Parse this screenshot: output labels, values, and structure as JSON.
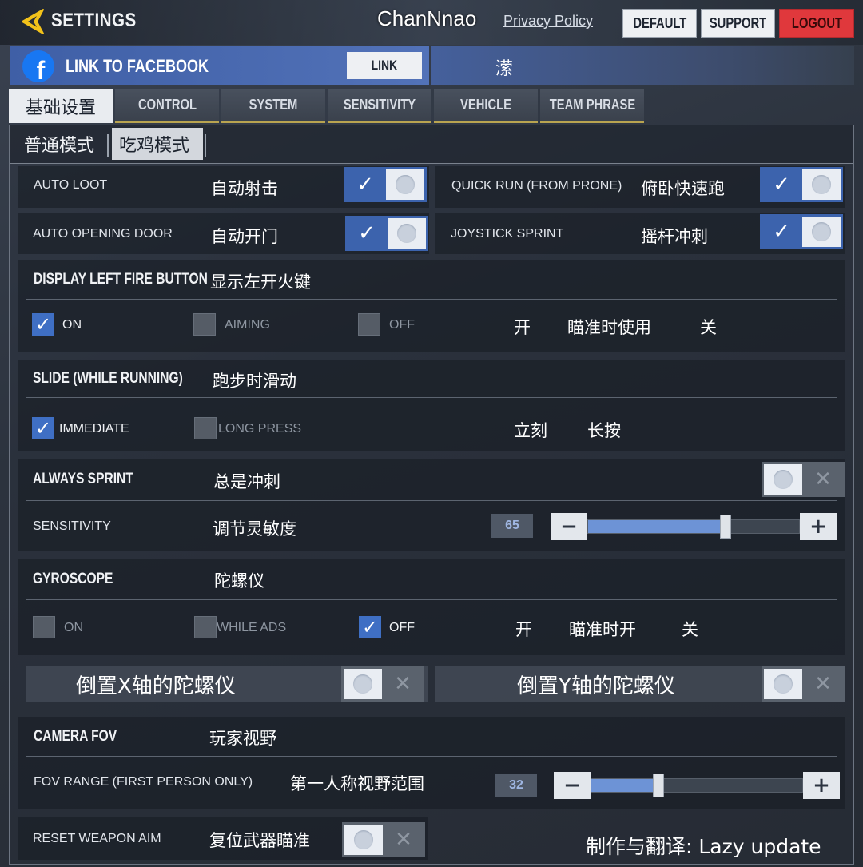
{
  "header": {
    "title": "SETTINGS",
    "player_name": "ChanNnao",
    "privacy_link": "Privacy Policy",
    "buttons": {
      "default": "DEFAULT",
      "support": "SUPPORT",
      "logout": "LOGOUT"
    }
  },
  "facebook": {
    "label": "LINK TO FACEBOOK",
    "button": "LINK",
    "icon_letter": "f",
    "side_text": "潆"
  },
  "tabs": [
    {
      "label": "基础设置",
      "active": true
    },
    {
      "label": "CONTROL"
    },
    {
      "label": "SYSTEM"
    },
    {
      "label": "SENSITIVITY"
    },
    {
      "label": "VEHICLE"
    },
    {
      "label": "TEAM PHRASE"
    }
  ],
  "subtabs": [
    {
      "label": "普通模式"
    },
    {
      "label": "吃鸡模式",
      "active": true
    }
  ],
  "rows": {
    "auto_loot": {
      "label": "AUTO LOOT",
      "cn": "自动射击",
      "enabled": true
    },
    "quick_run": {
      "label": "QUICK RUN (FROM PRONE)",
      "cn": "俯卧快速跑",
      "enabled": true
    },
    "auto_door": {
      "label": "AUTO OPENING DOOR",
      "cn": "自动开门",
      "enabled": true
    },
    "joystick_sprint": {
      "label": "JOYSTICK SPRINT",
      "cn": "摇杆冲刺",
      "enabled": true
    }
  },
  "left_fire": {
    "title": "DISPLAY LEFT FIRE BUTTON",
    "cn": "显示左开火键",
    "options": [
      "ON",
      "AIMING",
      "OFF"
    ],
    "selected": "ON",
    "cn_options": [
      "开",
      "瞄准时使用",
      "关"
    ]
  },
  "slide": {
    "title": "SLIDE (WHILE RUNNING)",
    "cn": "跑步时滑动",
    "options": [
      "IMMEDIATE",
      "LONG PRESS"
    ],
    "selected": "IMMEDIATE",
    "cn_options": [
      "立刻",
      "长按"
    ]
  },
  "always_sprint": {
    "title": "ALWAYS SPRINT",
    "cn": "总是冲刺",
    "enabled": false,
    "sensitivity_label": "SENSITIVITY",
    "sensitivity_cn": "调节灵敏度",
    "sensitivity_value": "65",
    "sensitivity_fraction": 0.65
  },
  "gyroscope": {
    "title": "GYROSCOPE",
    "cn": "陀螺仪",
    "options": [
      "ON",
      "WHILE ADS",
      "OFF"
    ],
    "selected": "OFF",
    "cn_options": [
      "开",
      "瞄准时开",
      "关"
    ],
    "invert_x_cn": "倒置X轴的陀螺仪",
    "invert_x_enabled": false,
    "invert_y_cn": "倒置Y轴的陀螺仪",
    "invert_y_enabled": false
  },
  "camera_fov": {
    "title": "CAMERA FOV",
    "cn": "玩家视野",
    "range_label": "FOV RANGE (FIRST PERSON ONLY)",
    "range_cn": "第一人称视野范围",
    "range_value": "32",
    "range_fraction": 0.32
  },
  "reset_aim": {
    "label": "RESET WEAPON AIM",
    "cn": "复位武器瞄准",
    "enabled": false
  },
  "credit": "制作与翻译: Lazy update",
  "icons": {
    "check": "✓",
    "cross": "✕",
    "minus": "−",
    "plus": "+"
  },
  "colors": {
    "accent": "#3c63ad",
    "logout": "#e0383c",
    "facebook": "#1877f2"
  }
}
